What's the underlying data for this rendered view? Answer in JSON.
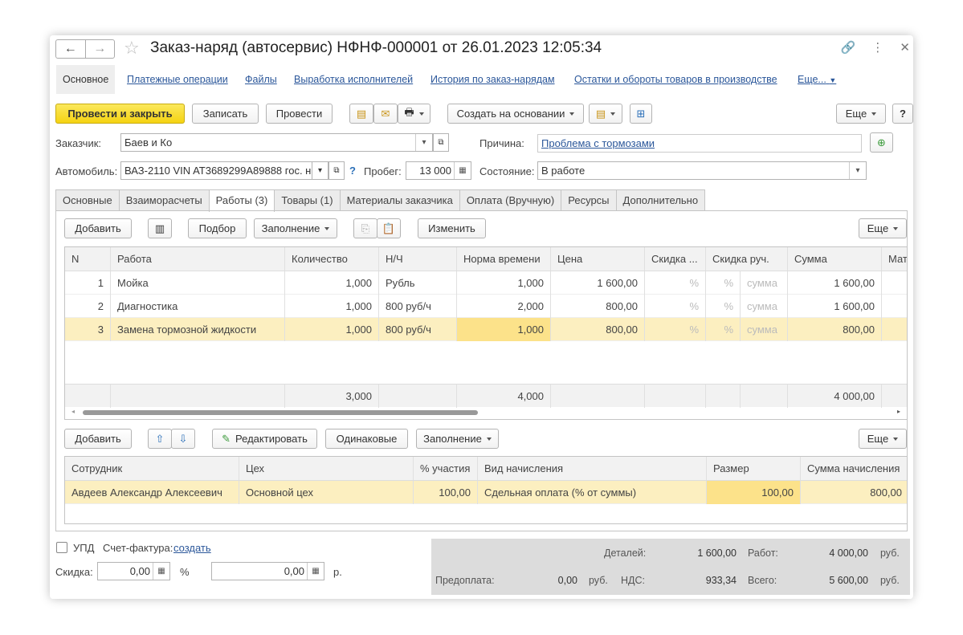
{
  "window": {
    "title": "Заказ-наряд (автосервис) НФНФ-000001 от 26.01.2023 12:05:34"
  },
  "navbar": {
    "items": [
      "Основное",
      "Платежные операции",
      "Файлы",
      "Выработка исполнителей",
      "История по заказ-нарядам",
      "Остатки и обороты товаров в производстве",
      "Еще..."
    ]
  },
  "toolbar": {
    "post_close": "Провести и закрыть",
    "save": "Записать",
    "post": "Провести",
    "create_based": "Создать на основании",
    "more": "Еще",
    "help": "?"
  },
  "form": {
    "customer_label": "Заказчик:",
    "customer": "Баев и Ко",
    "reason_label": "Причина:",
    "reason": "Проблема с тормозами",
    "car_label": "Автомобиль:",
    "car": "ВАЗ-2110 VIN AT3689299A89888 гос. н",
    "mileage_label": "Пробег:",
    "mileage": "13 000",
    "state_label": "Состояние:",
    "state": "В работе",
    "help_mark": "?"
  },
  "tabs": [
    "Основные",
    "Взаиморасчеты",
    "Работы (3)",
    "Товары (1)",
    "Материалы заказчика",
    "Оплата (Вручную)",
    "Ресурсы",
    "Дополнительно"
  ],
  "works_toolbar": {
    "add": "Добавить",
    "pick": "Подбор",
    "fill": "Заполнение",
    "change": "Изменить",
    "more": "Еще"
  },
  "works_table": {
    "headers": [
      "N",
      "Работа",
      "Количество",
      "Н/Ч",
      "Норма времени",
      "Цена",
      "Скидка ...",
      "Скидка руч.",
      "Сумма",
      "Мат"
    ],
    "rows": [
      {
        "n": "1",
        "work": "Мойка",
        "qty": "1,000",
        "nh": "Рубль",
        "norm": "1,000",
        "price": "1 600,00",
        "pct1": "%",
        "pct2": "%",
        "amt": "сумма",
        "sum": "1 600,00"
      },
      {
        "n": "2",
        "work": "Диагностика",
        "qty": "1,000",
        "nh": "800 руб/ч",
        "norm": "2,000",
        "price": "800,00",
        "pct1": "%",
        "pct2": "%",
        "amt": "сумма",
        "sum": "1 600,00"
      },
      {
        "n": "3",
        "work": "Замена тормозной жидкости",
        "qty": "1,000",
        "nh": "800 руб/ч",
        "norm": "1,000",
        "price": "800,00",
        "pct1": "%",
        "pct2": "%",
        "amt": "сумма",
        "sum": "800,00"
      }
    ],
    "totals": {
      "qty": "3,000",
      "norm": "4,000",
      "sum": "4 000,00"
    }
  },
  "staff_toolbar": {
    "add": "Добавить",
    "edit": "Редактировать",
    "same": "Одинаковые",
    "fill": "Заполнение",
    "more": "Еще"
  },
  "staff_table": {
    "headers": [
      "Сотрудник",
      "Цех",
      "% участия",
      "Вид начисления",
      "Размер",
      "Сумма начисления"
    ],
    "rows": [
      {
        "employee": "Авдеев Александр Алексеевич",
        "shop": "Основной цех",
        "pct": "100,00",
        "kind": "Сдельная оплата (% от суммы)",
        "size": "100,00",
        "sum": "800,00"
      }
    ]
  },
  "bottom": {
    "upd": "УПД",
    "invoice_label": "Счет-фактура:",
    "invoice_link": "создать",
    "discount_label": "Скидка:",
    "discount_pct": "0,00",
    "pct_sign": "%",
    "discount_rub": "0,00",
    "rub_sign": "р."
  },
  "summary": {
    "parts_label": "Деталей:",
    "parts": "1 600,00",
    "works_label": "Работ:",
    "works": "4 000,00",
    "prepay_label": "Предоплата:",
    "prepay": "0,00",
    "vat_label": "НДС:",
    "vat": "933,34",
    "total_label": "Всего:",
    "total": "5 600,00",
    "currency": "руб."
  }
}
